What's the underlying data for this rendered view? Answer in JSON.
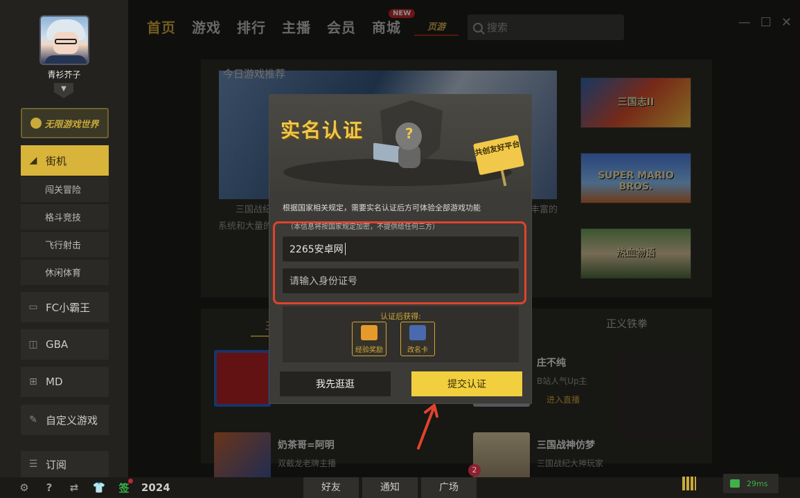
{
  "sidebar": {
    "username": "青衫芥子",
    "brand_logo": "无限游戏世界",
    "arcade": {
      "label": "街机",
      "icon": "joystick-icon"
    },
    "arcade_sub": [
      "闯关冒险",
      "格斗竞技",
      "飞行射击",
      "休闲体育"
    ],
    "platforms": [
      {
        "label": "FC小霸王",
        "icon": "gamepad-icon"
      },
      {
        "label": "GBA",
        "icon": "handheld-icon"
      },
      {
        "label": "MD",
        "icon": "controller-icon"
      },
      {
        "label": "自定义游戏",
        "icon": "edit-icon"
      },
      {
        "label": "订阅",
        "icon": "subscribe-icon"
      }
    ]
  },
  "topnav": {
    "items": [
      "首页",
      "游戏",
      "排行",
      "主播",
      "会员",
      "商城"
    ],
    "active": "首页",
    "new_badge": "NEW",
    "yeyou_logo": "页游",
    "search_placeholder": "搜索"
  },
  "window_controls": {
    "minimize": "—",
    "maximize": "☐",
    "close": "✕"
  },
  "main": {
    "recommend_title": "今日游戏推荐",
    "recommend_desc_left": "三国战纪",
    "recommend_desc_left2": "系统和大量的",
    "recommend_desc_right": "丰富的",
    "thumbs": [
      "三国志II",
      "SUPER MARIO BROS.",
      "热血物语"
    ],
    "tab_right": "正义铁拳",
    "tab_left_partial": "三",
    "streamers": [
      {
        "name": "庄不纯",
        "desc": "B站人气Up主",
        "action": "进入直播"
      },
      {
        "name": "奶茶哥=阿明",
        "desc": "双截龙老牌主播"
      },
      {
        "name": "三国战神仿梦",
        "desc": "三国战纪大神玩家"
      }
    ]
  },
  "modal": {
    "title": "实名认证",
    "sign_text": "共创友好平台",
    "info": "根据国家相关规定，需要实名认证后方可体验全部游戏功能",
    "note": "（本信息将按国家规定加密，不提供给任何三方）",
    "name_value": "2265安卓网",
    "id_placeholder": "请输入身份证号",
    "reward_title": "认证后获得:",
    "rewards": [
      "经验奖励",
      "改名卡"
    ],
    "later_button": "我先逛逛",
    "submit_button": "提交认证"
  },
  "bottombar": {
    "sign_label": "签",
    "year": "2024",
    "tabs": [
      "好友",
      "通知",
      "广场"
    ],
    "notify_count": "2",
    "ping": "29ms"
  },
  "colors": {
    "accent": "#d4a83a",
    "submit_yellow": "#f2cf3e",
    "highlight_red": "#e0432d",
    "background": "#1d1c18"
  }
}
